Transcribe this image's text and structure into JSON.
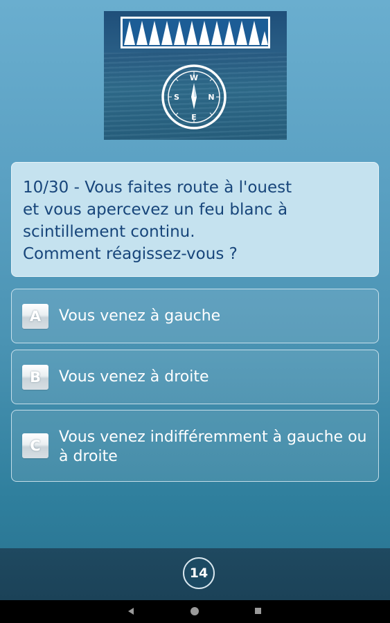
{
  "header": {
    "image_icon": "compass-icon",
    "compass_labels": [
      "W",
      "N",
      "E",
      "S"
    ]
  },
  "question": {
    "text": "10/30 - Vous faites route à l'ouest\net vous apercevez un feu blanc à\nscintillement continu.\nComment réagissez-vous ?"
  },
  "answers": [
    {
      "letter": "A",
      "text": "Vous venez à gauche"
    },
    {
      "letter": "B",
      "text": "Vous venez à droite"
    },
    {
      "letter": "C",
      "text": "Vous venez indifféremment à gauche ou à droite"
    }
  ],
  "footer": {
    "score": "14"
  },
  "colors": {
    "question_text": "#17457a",
    "question_bg": "#c5e2ef",
    "bottom_bar": "#1f4960",
    "background_top": "#6aaecf",
    "background_bottom": "#276f8c"
  },
  "nav": {
    "icons": [
      "back-icon",
      "home-icon",
      "recent-apps-icon"
    ]
  }
}
